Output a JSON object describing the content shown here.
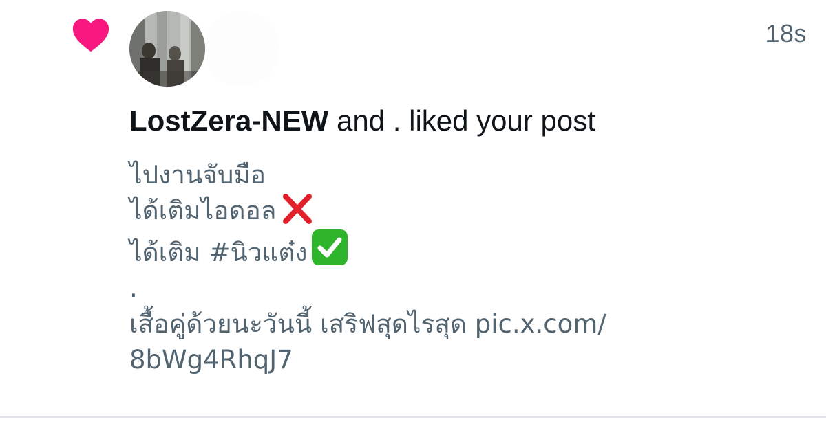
{
  "notification": {
    "timestamp": "18s",
    "actor_name": "LostZera-NEW",
    "action_text": " and . liked your post",
    "heart_color": "#f91880",
    "post_lines": [
      "ไปงานจับมือ",
      "ได้เติมไอดอล",
      "ได้เติม #นิวแต๋ง",
      ".",
      "เสื้อคู่ด้วยนะวันนี้ เสริฟสุดไรสุด pic.x.com/",
      "8bWg4RhqJ7"
    ],
    "icons": {
      "like": "heart-icon",
      "cross": "cross-mark-icon",
      "check": "check-mark-icon"
    }
  }
}
